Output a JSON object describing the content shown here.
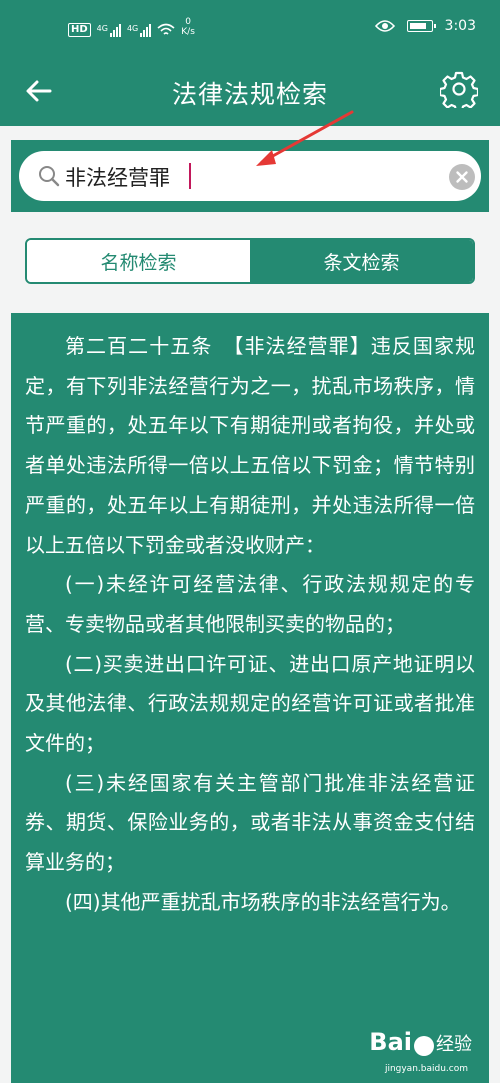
{
  "status_bar": {
    "hd_badge": "HD",
    "net1": "4G",
    "net2": "4G",
    "speed_value": "0",
    "speed_unit": "K/s",
    "battery_level": 0.85,
    "time": "3:03"
  },
  "app_bar": {
    "title": "法律法规检索",
    "back_icon": "arrow-left-icon",
    "settings_icon": "gear-icon"
  },
  "search": {
    "value": "非法经营罪",
    "icon": "search-icon",
    "clear_icon": "clear-icon"
  },
  "tabs": [
    {
      "label": "名称检索",
      "selected": false
    },
    {
      "label": "条文检索",
      "selected": true
    }
  ],
  "result": {
    "paragraphs": [
      "第二百二十五条　【非法经营罪】违反国家规定，有下列非法经营行为之一，扰乱市场秩序，情节严重的，处五年以下有期徒刑或者拘役，并处或者单处违法所得一倍以上五倍以下罚金；情节特别严重的，处五年以上有期徒刑，并处违法所得一倍以上五倍以下罚金或者没收财产：",
      "(一)未经许可经营法律、行政法规规定的专营、专卖物品或者其他限制买卖的物品的；",
      "(二)买卖进出口许可证、进出口原产地证明以及其他法律、行政法规规定的经营许可证或者批准文件的；",
      "(三)未经国家有关主管部门批准非法经营证券、期货、保险业务的，或者非法从事资金支付结算业务的；",
      "(四)其他严重扰乱市场秩序的非法经营行为。"
    ]
  },
  "watermark": {
    "logo": "Bai",
    "brand": "经验",
    "url": "jingyan.baidu.com"
  },
  "colors": {
    "primary": "#248a72",
    "annotation_arrow": "#e53935",
    "caret": "#c2185b"
  }
}
